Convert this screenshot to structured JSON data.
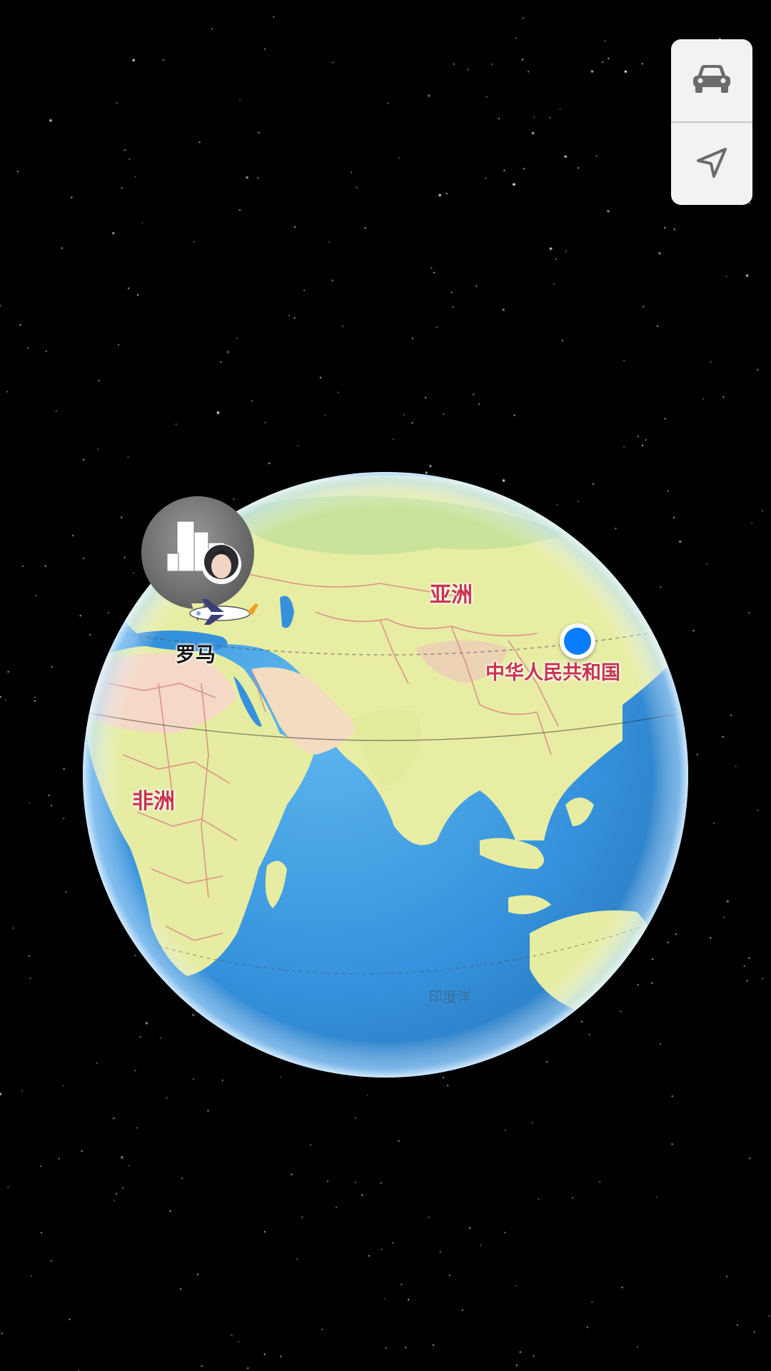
{
  "controls": {
    "drive_icon": "car-icon",
    "locate_icon": "navigation-arrow-icon"
  },
  "map": {
    "labels": {
      "asia": "亚洲",
      "africa": "非洲",
      "china": "中华人民共和国",
      "indian_ocean": "印度洋",
      "rome": "罗马"
    },
    "colors": {
      "space": "#000000",
      "ocean": "#3f9be0",
      "land": "#e9eea8",
      "desert": "#f5d9c7",
      "border": "#d98484",
      "continent_label": "#c8344e",
      "location_dot": "#0a7cff"
    }
  }
}
